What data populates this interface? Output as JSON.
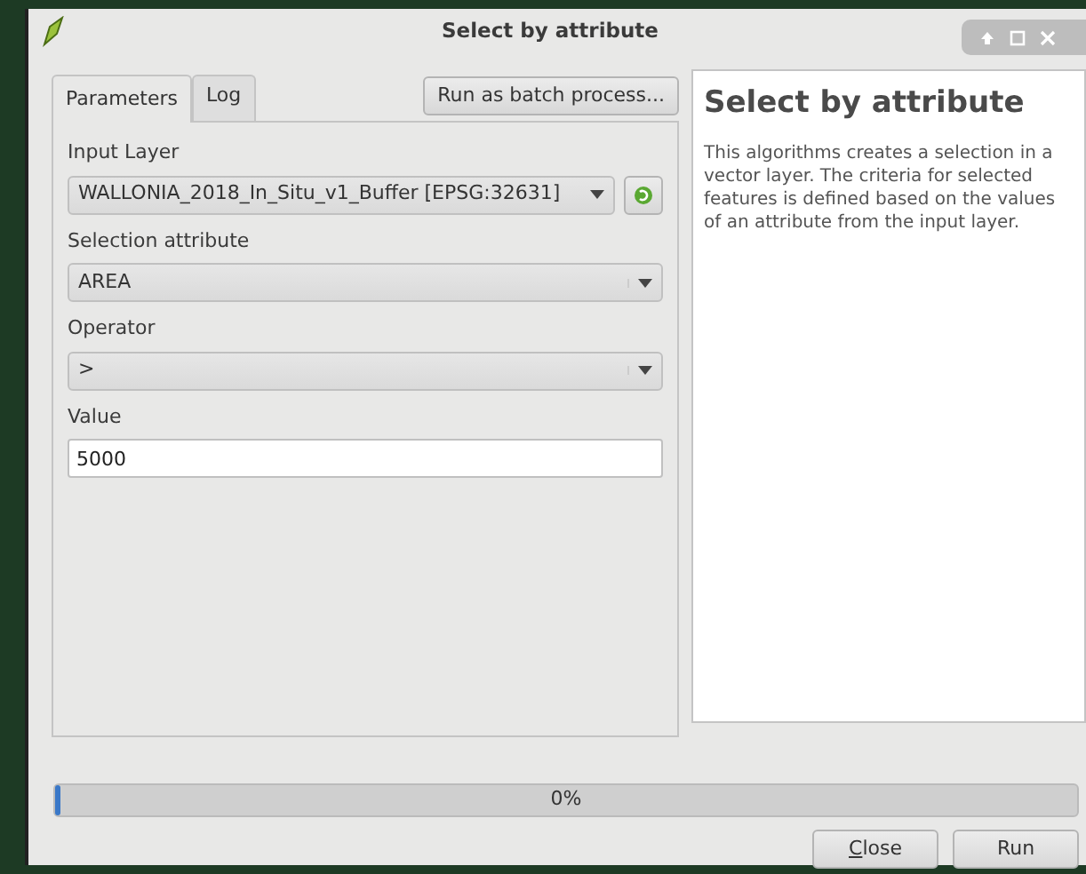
{
  "window": {
    "title": "Select by attribute"
  },
  "tabs": [
    {
      "label": "Parameters",
      "selected": true
    },
    {
      "label": "Log",
      "selected": false
    }
  ],
  "batch_button": "Run as batch process...",
  "parameters": [
    {
      "kind": "layer",
      "label": "Input Layer",
      "value": "WALLONIA_2018_In_Situ_v1_Buffer [EPSG:32631]"
    },
    {
      "kind": "select",
      "label": "Selection attribute",
      "value": "AREA"
    },
    {
      "kind": "select",
      "label": "Operator",
      "value": ">"
    },
    {
      "kind": "text",
      "label": "Value",
      "value": "5000"
    }
  ],
  "help": {
    "title": "Select by attribute",
    "text": "This algorithms creates a selection in a vector layer. The criteria for selected features is defined based on the values of an attribute from the input layer."
  },
  "progress": {
    "level": 0,
    "reading": "0%"
  },
  "buttons": [
    "Close",
    "Run"
  ]
}
